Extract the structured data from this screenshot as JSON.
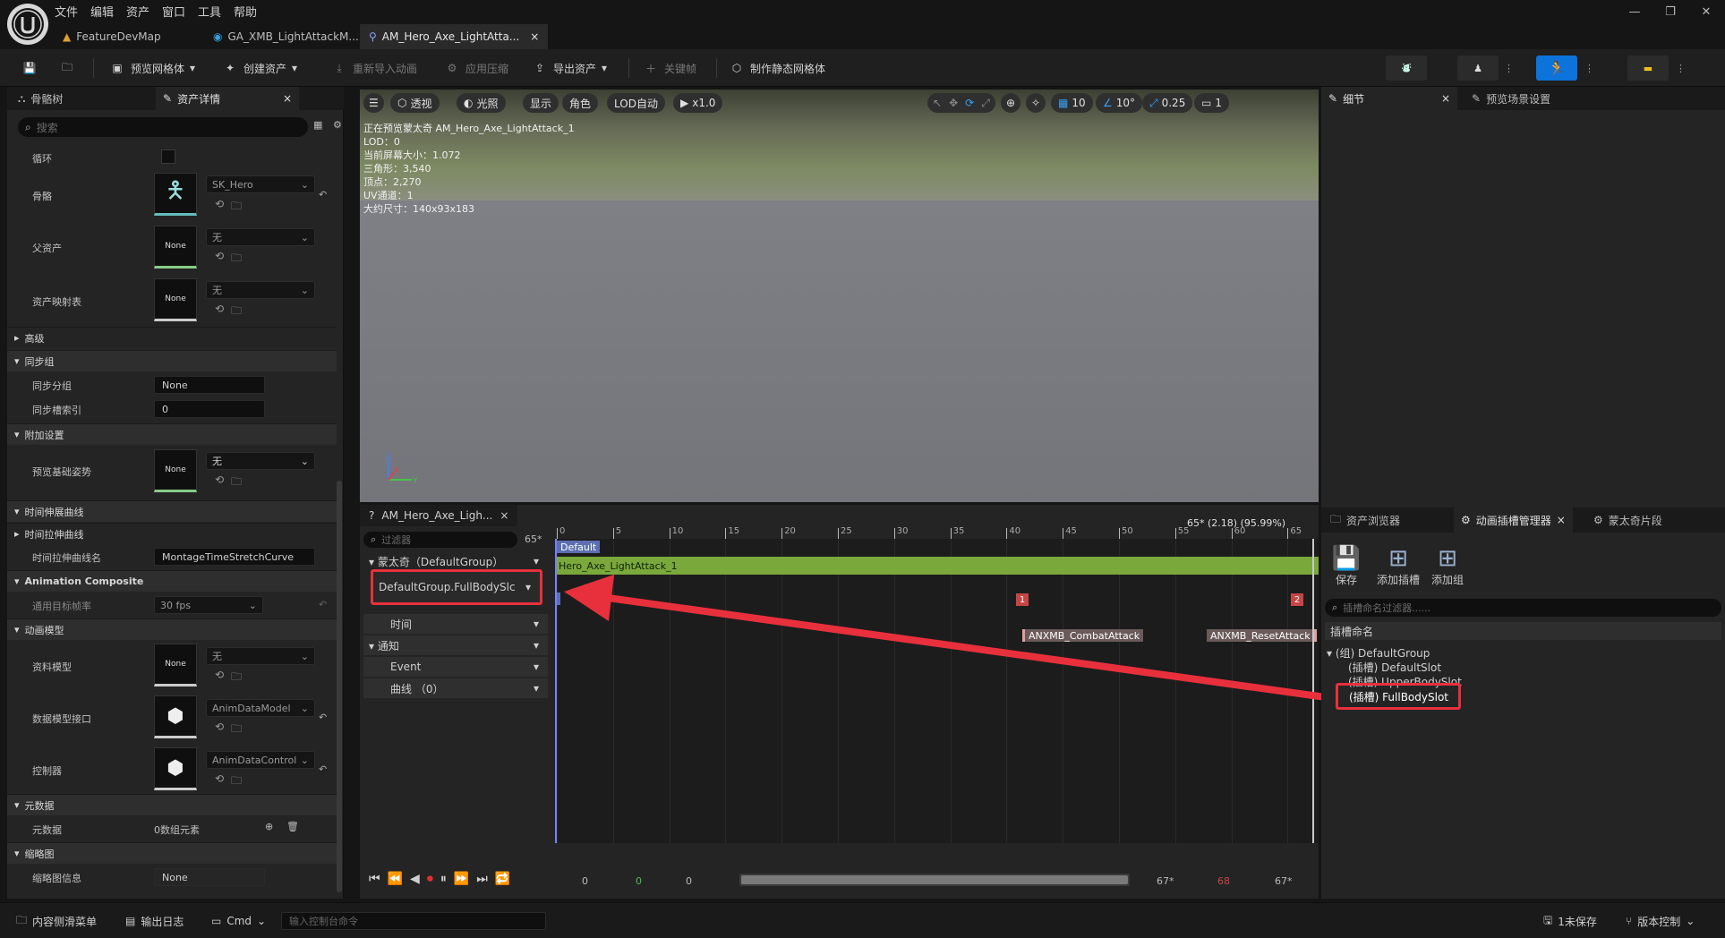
{
  "menu": [
    "文件",
    "编辑",
    "资产",
    "窗口",
    "工具",
    "帮助"
  ],
  "tabs": [
    {
      "label": "FeatureDevMap"
    },
    {
      "label": "GA_XMB_LightAttackM..."
    },
    {
      "label": "AM_Hero_Axe_LightAtta..."
    }
  ],
  "toolbar": {
    "preview_mesh": "预览网格体",
    "create_asset": "创建资产",
    "reimport": "重新导入动画",
    "apply_compress": "应用压缩",
    "export_asset": "导出资产",
    "keyframe": "关键帧",
    "make_static_mesh": "制作静态网格体"
  },
  "left": {
    "tab_skeleton": "骨骼树",
    "tab_details": "资产详情",
    "search_placeholder": "搜索",
    "loop": "循环",
    "skeleton": "骨骼",
    "skeleton_value": "SK_Hero",
    "parent_asset": "父资产",
    "none_value": "无",
    "asset_map": "资产映射表",
    "none_thumb": "None",
    "advanced": "高级",
    "sync_group": "同步组",
    "sync_group_name": "同步分组",
    "sync_group_value": "None",
    "sync_marker_index": "同步槽索引",
    "sync_marker_value": "0",
    "additive": "附加设置",
    "preview_base_pose": "预览基础姿势",
    "time_stretch": "时间伸展曲线",
    "time_stretch_curve": "时间拉伸曲线",
    "time_stretch_name": "时间拉伸曲线名",
    "time_stretch_value": "MontageTimeStretchCurve",
    "anim_composite": "Animation Composite",
    "target_frame_rate": "通用目标帧率",
    "fps_value": "30 fps",
    "anim_model": "动画模型",
    "data_model": "资料模型",
    "data_model_iface": "数据模型接口",
    "data_model_iface_value": "AnimDataModel",
    "controller": "控制器",
    "controller_value": "AnimDataControl",
    "metadata": "元数据",
    "metadata_row": "元数据",
    "metadata_value": "0数组元素",
    "thumbnail": "缩略图",
    "thumbnail_info": "缩略图信息",
    "thumbnail_value": "None"
  },
  "viewport": {
    "perspective": "透视",
    "lit": "光照",
    "show": "显示",
    "character": "角色",
    "lod_auto": "LOD自动",
    "play_rate": "x1.0",
    "grid_value": "10",
    "angle_value": "10°",
    "scale_value": "0.25",
    "cam_value": "1",
    "stats": [
      "正在预览蒙太奇 AM_Hero_Axe_LightAttack_1",
      "LOD：0",
      "当前屏幕大小：1.072",
      "三角形：3,540",
      "顶点：2,270",
      "UV通道：1",
      "大约尺寸：140x93x183"
    ]
  },
  "sequencer": {
    "tab": "AM_Hero_Axe_Ligh...",
    "filter_placeholder": "过滤器",
    "frame_small": "65*",
    "montage_row": "蒙太奇（DefaultGroup）",
    "slot_row": "DefaultGroup.FullBodySlc",
    "time_row": "时间",
    "notify_row": "通知",
    "event_row": "Event",
    "curve_row": "曲线 （0）",
    "ticks": [
      "0",
      "5",
      "10",
      "15",
      "20",
      "25",
      "30",
      "35",
      "40",
      "45",
      "50",
      "55",
      "60",
      "65"
    ],
    "cursor_readout": "65* (2.18) (95.99%)",
    "section_label": "Default",
    "segment_label": "Hero_Axe_LightAttack_1",
    "marker1": "1",
    "marker2": "2",
    "notify1": "ANXMB_CombatAttack",
    "notify2": "ANXMB_ResetAttack",
    "play_fields": [
      "0",
      "0",
      "0"
    ],
    "end_fields": [
      "67*",
      "68",
      "67*"
    ]
  },
  "right": {
    "tab_details": "细节",
    "tab_scene": "预览场景设置",
    "tab_browser": "资产浏览器",
    "tab_slot_mgr": "动画插槽管理器",
    "tab_montage": "蒙太奇片段",
    "save": "保存",
    "add_slot": "添加插槽",
    "add_group": "添加组",
    "filter_placeholder": "插槽命名过滤器......",
    "header": "插槽命名",
    "group": "(组) DefaultGroup",
    "slots": [
      "(插槽) DefaultSlot",
      "(插槽) UpperBodySlot",
      "(插槽) FullBodySlot"
    ]
  },
  "bottom": {
    "content_drawer": "内容侧滑菜单",
    "output_log": "输出日志",
    "cmd": "Cmd",
    "console_placeholder": "输入控制台命令",
    "unsaved": "1未保存",
    "version_control": "版本控制"
  },
  "colors": {
    "accent_blue": "#0c73db",
    "highlight_red": "#e8303c",
    "track_green": "#7aa83a"
  }
}
